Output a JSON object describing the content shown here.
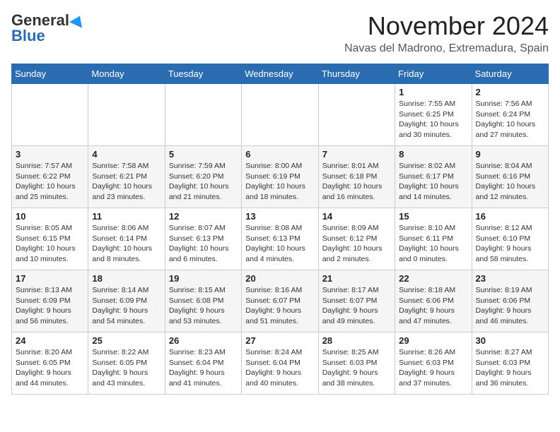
{
  "header": {
    "logo_line1": "General",
    "logo_line2": "Blue",
    "month": "November 2024",
    "location": "Navas del Madrono, Extremadura, Spain"
  },
  "weekdays": [
    "Sunday",
    "Monday",
    "Tuesday",
    "Wednesday",
    "Thursday",
    "Friday",
    "Saturday"
  ],
  "weeks": [
    [
      {
        "day": "",
        "info": ""
      },
      {
        "day": "",
        "info": ""
      },
      {
        "day": "",
        "info": ""
      },
      {
        "day": "",
        "info": ""
      },
      {
        "day": "",
        "info": ""
      },
      {
        "day": "1",
        "info": "Sunrise: 7:55 AM\nSunset: 6:25 PM\nDaylight: 10 hours\nand 30 minutes."
      },
      {
        "day": "2",
        "info": "Sunrise: 7:56 AM\nSunset: 6:24 PM\nDaylight: 10 hours\nand 27 minutes."
      }
    ],
    [
      {
        "day": "3",
        "info": "Sunrise: 7:57 AM\nSunset: 6:22 PM\nDaylight: 10 hours\nand 25 minutes."
      },
      {
        "day": "4",
        "info": "Sunrise: 7:58 AM\nSunset: 6:21 PM\nDaylight: 10 hours\nand 23 minutes."
      },
      {
        "day": "5",
        "info": "Sunrise: 7:59 AM\nSunset: 6:20 PM\nDaylight: 10 hours\nand 21 minutes."
      },
      {
        "day": "6",
        "info": "Sunrise: 8:00 AM\nSunset: 6:19 PM\nDaylight: 10 hours\nand 18 minutes."
      },
      {
        "day": "7",
        "info": "Sunrise: 8:01 AM\nSunset: 6:18 PM\nDaylight: 10 hours\nand 16 minutes."
      },
      {
        "day": "8",
        "info": "Sunrise: 8:02 AM\nSunset: 6:17 PM\nDaylight: 10 hours\nand 14 minutes."
      },
      {
        "day": "9",
        "info": "Sunrise: 8:04 AM\nSunset: 6:16 PM\nDaylight: 10 hours\nand 12 minutes."
      }
    ],
    [
      {
        "day": "10",
        "info": "Sunrise: 8:05 AM\nSunset: 6:15 PM\nDaylight: 10 hours\nand 10 minutes."
      },
      {
        "day": "11",
        "info": "Sunrise: 8:06 AM\nSunset: 6:14 PM\nDaylight: 10 hours\nand 8 minutes."
      },
      {
        "day": "12",
        "info": "Sunrise: 8:07 AM\nSunset: 6:13 PM\nDaylight: 10 hours\nand 6 minutes."
      },
      {
        "day": "13",
        "info": "Sunrise: 8:08 AM\nSunset: 6:13 PM\nDaylight: 10 hours\nand 4 minutes."
      },
      {
        "day": "14",
        "info": "Sunrise: 8:09 AM\nSunset: 6:12 PM\nDaylight: 10 hours\nand 2 minutes."
      },
      {
        "day": "15",
        "info": "Sunrise: 8:10 AM\nSunset: 6:11 PM\nDaylight: 10 hours\nand 0 minutes."
      },
      {
        "day": "16",
        "info": "Sunrise: 8:12 AM\nSunset: 6:10 PM\nDaylight: 9 hours\nand 58 minutes."
      }
    ],
    [
      {
        "day": "17",
        "info": "Sunrise: 8:13 AM\nSunset: 6:09 PM\nDaylight: 9 hours\nand 56 minutes."
      },
      {
        "day": "18",
        "info": "Sunrise: 8:14 AM\nSunset: 6:09 PM\nDaylight: 9 hours\nand 54 minutes."
      },
      {
        "day": "19",
        "info": "Sunrise: 8:15 AM\nSunset: 6:08 PM\nDaylight: 9 hours\nand 53 minutes."
      },
      {
        "day": "20",
        "info": "Sunrise: 8:16 AM\nSunset: 6:07 PM\nDaylight: 9 hours\nand 51 minutes."
      },
      {
        "day": "21",
        "info": "Sunrise: 8:17 AM\nSunset: 6:07 PM\nDaylight: 9 hours\nand 49 minutes."
      },
      {
        "day": "22",
        "info": "Sunrise: 8:18 AM\nSunset: 6:06 PM\nDaylight: 9 hours\nand 47 minutes."
      },
      {
        "day": "23",
        "info": "Sunrise: 8:19 AM\nSunset: 6:06 PM\nDaylight: 9 hours\nand 46 minutes."
      }
    ],
    [
      {
        "day": "24",
        "info": "Sunrise: 8:20 AM\nSunset: 6:05 PM\nDaylight: 9 hours\nand 44 minutes."
      },
      {
        "day": "25",
        "info": "Sunrise: 8:22 AM\nSunset: 6:05 PM\nDaylight: 9 hours\nand 43 minutes."
      },
      {
        "day": "26",
        "info": "Sunrise: 8:23 AM\nSunset: 6:04 PM\nDaylight: 9 hours\nand 41 minutes."
      },
      {
        "day": "27",
        "info": "Sunrise: 8:24 AM\nSunset: 6:04 PM\nDaylight: 9 hours\nand 40 minutes."
      },
      {
        "day": "28",
        "info": "Sunrise: 8:25 AM\nSunset: 6:03 PM\nDaylight: 9 hours\nand 38 minutes."
      },
      {
        "day": "29",
        "info": "Sunrise: 8:26 AM\nSunset: 6:03 PM\nDaylight: 9 hours\nand 37 minutes."
      },
      {
        "day": "30",
        "info": "Sunrise: 8:27 AM\nSunset: 6:03 PM\nDaylight: 9 hours\nand 36 minutes."
      }
    ]
  ]
}
